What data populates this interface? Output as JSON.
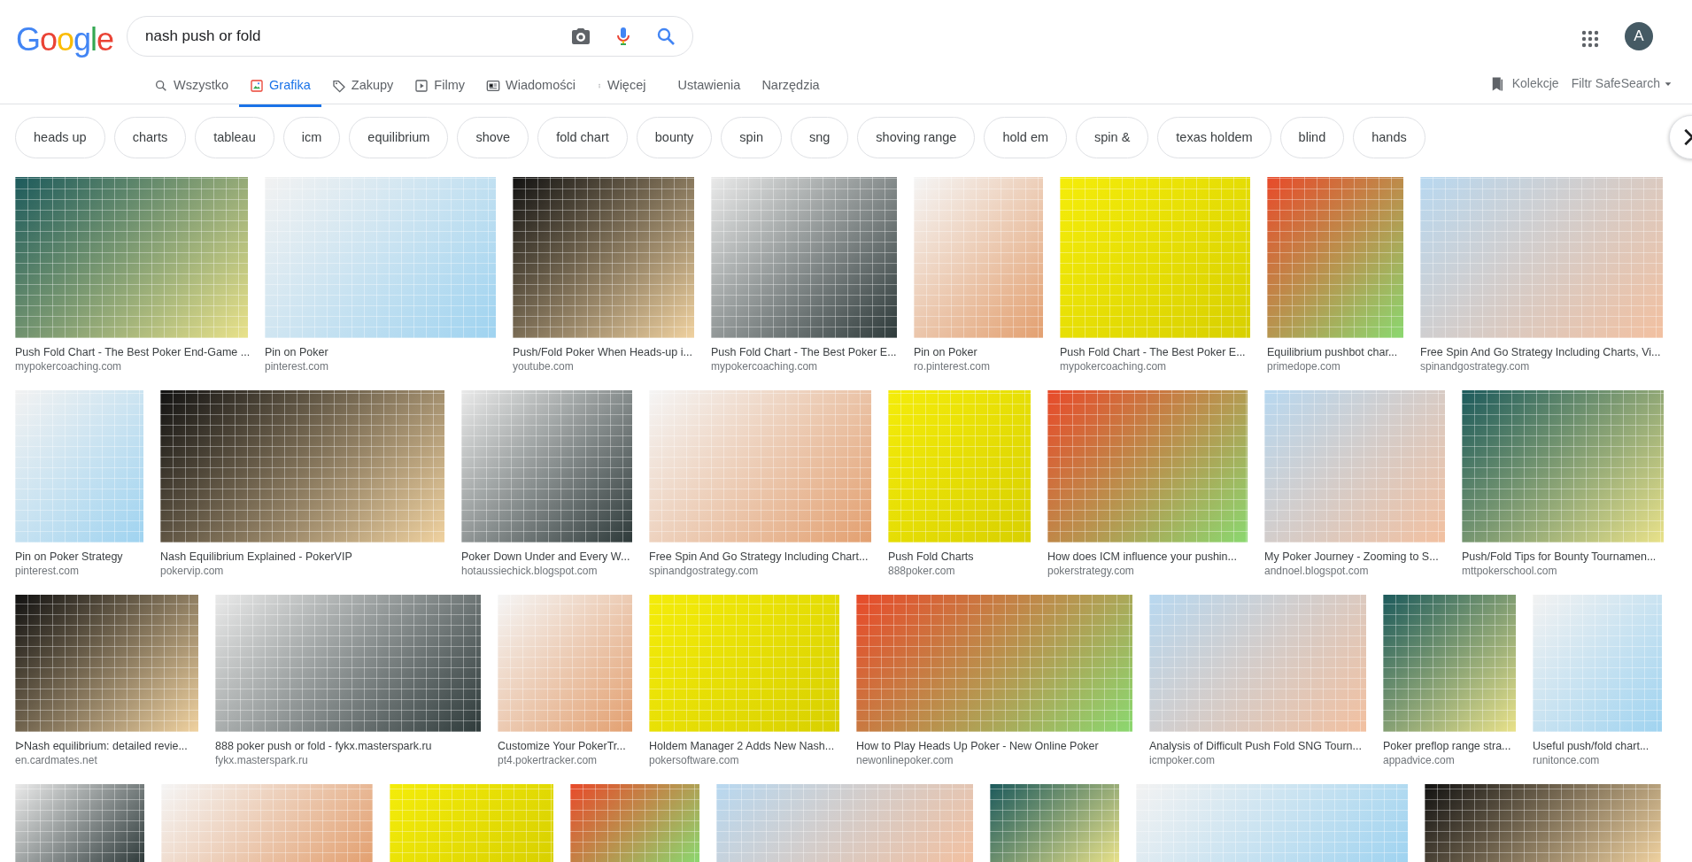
{
  "logo": "Google",
  "search": {
    "value": "nash push or fold"
  },
  "tabs": [
    {
      "label": "Wszystko",
      "selected": false
    },
    {
      "label": "Grafika",
      "selected": true
    },
    {
      "label": "Zakupy",
      "selected": false
    },
    {
      "label": "Filmy",
      "selected": false
    },
    {
      "label": "Wiadomości",
      "selected": false
    },
    {
      "label": "Więcej",
      "selected": false
    }
  ],
  "tools": [
    "Ustawienia",
    "Narzędzia"
  ],
  "collections": "Kolekcje",
  "safesearch": "Filtr SafeSearch",
  "avatar": "A",
  "chips": [
    "heads up",
    "charts",
    "tableau",
    "icm",
    "equilibrium",
    "shove",
    "fold chart",
    "bounty",
    "spin",
    "sng",
    "shoving range",
    "hold em",
    "spin &",
    "texas holdem",
    "blind",
    "hands"
  ],
  "results": [
    [
      {
        "title": "Push Fold Chart - The Best Poker End-Game ...",
        "source": "mypokercoaching.com"
      },
      {
        "title": "Pin on Poker",
        "source": "pinterest.com"
      },
      {
        "title": "Push/Fold Poker When Heads-up i...",
        "source": "youtube.com"
      },
      {
        "title": "Push Fold Chart - The Best Poker E...",
        "source": "mypokercoaching.com"
      },
      {
        "title": "Pin on Poker",
        "source": "ro.pinterest.com"
      },
      {
        "title": "Push Fold Chart - The Best Poker E...",
        "source": "mypokercoaching.com"
      },
      {
        "title": "Equilibrium pushbot char...",
        "source": "primedope.com"
      },
      {
        "title": "Free Spin And Go Strategy Including Charts, Vi...",
        "source": "spinandgostrategy.com"
      }
    ],
    [
      {
        "title": "Pin on Poker Strategy",
        "source": "pinterest.com"
      },
      {
        "title": "Nash Equilibrium Explained - PokerVIP",
        "source": "pokervip.com"
      },
      {
        "title": "Poker Down Under and Every W...",
        "source": "hotaussiechick.blogspot.com"
      },
      {
        "title": "Free Spin And Go Strategy Including Chart...",
        "source": "spinandgostrategy.com"
      },
      {
        "title": "Push Fold Charts",
        "source": "888poker.com"
      },
      {
        "title": "How does ICM influence your pushin...",
        "source": "pokerstrategy.com"
      },
      {
        "title": "My Poker Journey - Zooming to S...",
        "source": "andnoel.blogspot.com"
      },
      {
        "title": "Push/Fold Tips for Bounty Tournamen...",
        "source": "mttpokerschool.com"
      }
    ],
    [
      {
        "title": "ᐅNash equilibrium: detailed revie...",
        "source": "en.cardmates.net"
      },
      {
        "title": "888 poker push or fold - fykx.masterspark.ru",
        "source": "fykx.masterspark.ru"
      },
      {
        "title": "Customize Your PokerTr...",
        "source": "pt4.pokertracker.com"
      },
      {
        "title": "Holdem Manager 2 Adds New Nash...",
        "source": "pokersoftware.com"
      },
      {
        "title": "How to Play Heads Up Poker - New Online Poker",
        "source": "newonlinepoker.com"
      },
      {
        "title": "Analysis of Difficult Push Fold SNG Tourn...",
        "source": "icmpoker.com"
      },
      {
        "title": "Poker preflop range stra...",
        "source": "appadvice.com"
      },
      {
        "title": "Useful push/fold chart...",
        "source": "runitonce.com"
      }
    ]
  ]
}
